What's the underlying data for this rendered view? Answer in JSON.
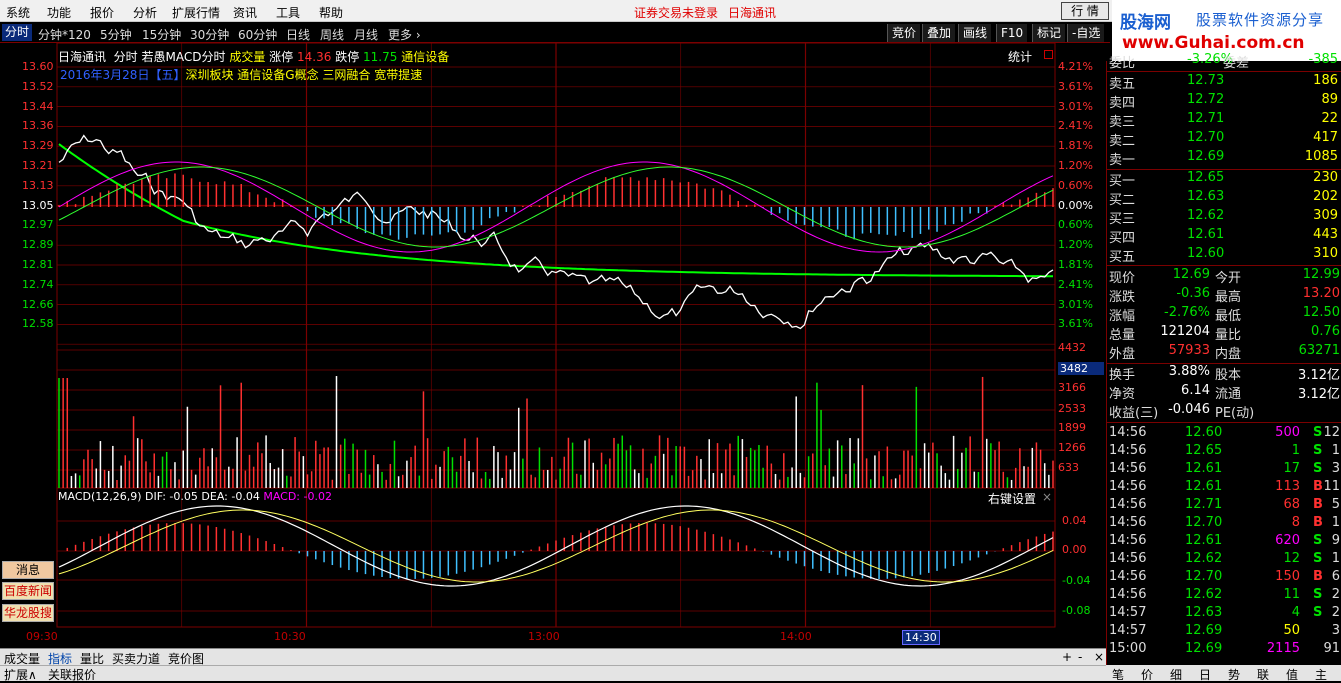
{
  "menu": {
    "items": [
      "系统",
      "功能",
      "报价",
      "分析",
      "扩展行情",
      "资讯",
      "工具",
      "帮助"
    ],
    "status_text": "证券交易未登录",
    "stock_name": "日海通讯",
    "quote_button": "行 情"
  },
  "logo": {
    "name": "股海网",
    "tagline": "股票软件资源分享",
    "url": "www.Guhai.com.cn"
  },
  "period_tabs": [
    "分时",
    "分钟*120",
    "5分钟",
    "15分钟",
    "30分钟",
    "60分钟",
    "日线",
    "周线",
    "月线",
    "更多 ›"
  ],
  "right_buttons": [
    "竞价",
    "叠加",
    "画线",
    "F10",
    "标记",
    "-自选"
  ],
  "chart_header": {
    "stock": "日海通讯",
    "mode": "分时",
    "indicator": "若愚MACD分时",
    "volume_label": "成交量",
    "limit_up_label": "涨停",
    "limit_up": "14.36",
    "limit_down_label": "跌停",
    "limit_down": "11.75",
    "sector": "通信设备",
    "stats": "统计"
  },
  "concept_line": {
    "date": "2016年3月28日",
    "weekday": "【五】",
    "tags": "深圳板块 通信设备G概念 三网融合 宽带提速"
  },
  "macd_header": {
    "title": "MACD(12,26,9)",
    "dif": "DIF: -0.05",
    "dea": "DEA: -0.04",
    "macd": "MACD: -0.02",
    "settings": "右键设置"
  },
  "price_axis": [
    "13.60",
    "13.52",
    "13.44",
    "13.36",
    "13.29",
    "13.21",
    "13.13",
    "13.05",
    "12.97",
    "12.89",
    "12.81",
    "12.74",
    "12.66",
    "12.58"
  ],
  "pct_axis": [
    "4.21%",
    "3.61%",
    "3.01%",
    "2.41%",
    "1.81%",
    "1.20%",
    "0.60%",
    "0.00%",
    "0.60%",
    "1.20%",
    "1.81%",
    "2.41%",
    "3.01%",
    "3.61%"
  ],
  "volume_axis": [
    "4432",
    "3482",
    "3166",
    "2533",
    "1899",
    "1266",
    "633"
  ],
  "macd_axis": [
    "0.04",
    "0.00",
    "-0.04",
    "-0.08"
  ],
  "time_axis": [
    "09:30",
    "10:30",
    "13:00",
    "14:00",
    "14:30"
  ],
  "side_buttons": [
    "消息",
    "百度新闻",
    "华龙股搜"
  ],
  "bottom_tabs": [
    "成交量",
    "指标",
    "量比",
    "买卖力道",
    "竞价图"
  ],
  "bottom_tabs2": [
    "扩展∧",
    "关联报价"
  ],
  "bottom_controls": [
    "+",
    "-",
    "×"
  ],
  "quote": {
    "weibi_label": "委比",
    "weibi": "-3.26%",
    "weicha_label": "委差",
    "weicha": "-385",
    "sells": [
      {
        "label": "卖五",
        "price": "12.73",
        "vol": "186"
      },
      {
        "label": "卖四",
        "price": "12.72",
        "vol": "89"
      },
      {
        "label": "卖三",
        "price": "12.71",
        "vol": "22"
      },
      {
        "label": "卖二",
        "price": "12.70",
        "vol": "417"
      },
      {
        "label": "卖一",
        "price": "12.69",
        "vol": "1085"
      }
    ],
    "buys": [
      {
        "label": "买一",
        "price": "12.65",
        "vol": "230"
      },
      {
        "label": "买二",
        "price": "12.63",
        "vol": "202"
      },
      {
        "label": "买三",
        "price": "12.62",
        "vol": "309"
      },
      {
        "label": "买四",
        "price": "12.61",
        "vol": "443"
      },
      {
        "label": "买五",
        "price": "12.60",
        "vol": "310"
      }
    ],
    "stats": [
      {
        "l1": "现价",
        "v1": "12.69",
        "l2": "今开",
        "v2": "12.99",
        "c1": "grn",
        "c2": "grn"
      },
      {
        "l1": "涨跌",
        "v1": "-0.36",
        "l2": "最高",
        "v2": "13.20",
        "c1": "grn",
        "c2": "red"
      },
      {
        "l1": "涨幅",
        "v1": "-2.76%",
        "l2": "最低",
        "v2": "12.50",
        "c1": "grn",
        "c2": "grn"
      },
      {
        "l1": "总量",
        "v1": "121204",
        "l2": "量比",
        "v2": "0.76",
        "c1": "wht",
        "c2": "grn"
      },
      {
        "l1": "外盘",
        "v1": "57933",
        "l2": "内盘",
        "v2": "63271",
        "c1": "red",
        "c2": "grn"
      }
    ],
    "stats2": [
      {
        "l1": "换手",
        "v1": "3.88%",
        "l2": "股本",
        "v2": "3.12亿"
      },
      {
        "l1": "净资",
        "v1": "6.14",
        "l2": "流通",
        "v2": "3.12亿"
      },
      {
        "l1": "收益(三)",
        "v1": "-0.046",
        "l2": "PE(动)",
        "v2": ""
      }
    ],
    "ticks": [
      {
        "t": "14:56",
        "p": "12.60",
        "v": "500",
        "bs": "S",
        "n": "12"
      },
      {
        "t": "14:56",
        "p": "12.65",
        "v": "1",
        "bs": "S",
        "n": "1"
      },
      {
        "t": "14:56",
        "p": "12.61",
        "v": "17",
        "bs": "S",
        "n": "3"
      },
      {
        "t": "14:56",
        "p": "12.61",
        "v": "113",
        "bs": "B",
        "n": "11"
      },
      {
        "t": "14:56",
        "p": "12.71",
        "v": "68",
        "bs": "B",
        "n": "5"
      },
      {
        "t": "14:56",
        "p": "12.70",
        "v": "8",
        "bs": "B",
        "n": "1"
      },
      {
        "t": "14:56",
        "p": "12.61",
        "v": "620",
        "bs": "S",
        "n": "9"
      },
      {
        "t": "14:56",
        "p": "12.62",
        "v": "12",
        "bs": "S",
        "n": "1"
      },
      {
        "t": "14:56",
        "p": "12.70",
        "v": "150",
        "bs": "B",
        "n": "6"
      },
      {
        "t": "14:56",
        "p": "12.62",
        "v": "11",
        "bs": "S",
        "n": "2"
      },
      {
        "t": "14:57",
        "p": "12.63",
        "v": "4",
        "bs": "S",
        "n": "2"
      },
      {
        "t": "14:57",
        "p": "12.69",
        "v": "50",
        "bs": "",
        "n": "3"
      },
      {
        "t": "15:00",
        "p": "12.69",
        "v": "2115",
        "bs": "",
        "n": "91"
      }
    ],
    "bottom_tabs": [
      "笔",
      "价",
      "细",
      "日",
      "势",
      "联",
      "值",
      "主"
    ]
  },
  "colors": {
    "up": "#ff3030",
    "down": "#00e000",
    "grid": "#7b0000",
    "price_line": "#ffffff",
    "avg_line": "#00ff00",
    "axis_text": "#c00000"
  }
}
